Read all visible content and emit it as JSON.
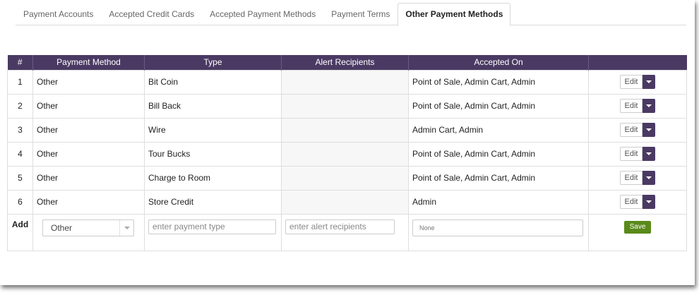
{
  "tabs": [
    {
      "label": "Payment Accounts"
    },
    {
      "label": "Accepted Credit Cards"
    },
    {
      "label": "Accepted Payment Methods"
    },
    {
      "label": "Payment Terms"
    },
    {
      "label": "Other Payment Methods"
    }
  ],
  "active_tab": "Other Payment Methods",
  "table": {
    "headers": [
      "#",
      "Payment Method",
      "Type",
      "Alert Recipients",
      "Accepted On",
      ""
    ],
    "rows": [
      {
        "num": "1",
        "method": "Other",
        "type": "Bit Coin",
        "alert": "",
        "accepted": "Point of Sale, Admin Cart, Admin",
        "edit": "Edit"
      },
      {
        "num": "2",
        "method": "Other",
        "type": "Bill Back",
        "alert": "",
        "accepted": "Point of Sale, Admin Cart, Admin",
        "edit": "Edit"
      },
      {
        "num": "3",
        "method": "Other",
        "type": "Wire",
        "alert": "",
        "accepted": "Admin Cart, Admin",
        "edit": "Edit"
      },
      {
        "num": "4",
        "method": "Other",
        "type": "Tour Bucks",
        "alert": "",
        "accepted": "Point of Sale, Admin Cart, Admin",
        "edit": "Edit"
      },
      {
        "num": "5",
        "method": "Other",
        "type": "Charge to Room",
        "alert": "",
        "accepted": "Point of Sale, Admin Cart, Admin",
        "edit": "Edit"
      },
      {
        "num": "6",
        "method": "Other",
        "type": "Store Credit",
        "alert": "",
        "accepted": "Admin",
        "edit": "Edit"
      }
    ]
  },
  "add_row": {
    "label": "Add",
    "method_selected": "Other",
    "type_placeholder": "enter payment type",
    "alert_placeholder": "enter alert recipients",
    "accepted_value": "None",
    "save_label": "Save"
  },
  "colors": {
    "header_bg": "#4a3a63",
    "save_bg": "#5a8a1a"
  }
}
